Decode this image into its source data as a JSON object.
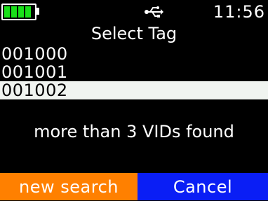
{
  "status_bar": {
    "battery_level": 1.0,
    "battery_color": "#19e019",
    "usb_icon": "usb-icon",
    "time": "11:56"
  },
  "screen": {
    "title": "Select Tag",
    "tags": [
      {
        "id": "001000",
        "selected": false
      },
      {
        "id": "001001",
        "selected": false
      },
      {
        "id": "001002",
        "selected": true
      }
    ],
    "message": "more than 3 VIDs found"
  },
  "softkeys": {
    "left_label": "new search",
    "left_color": "#ff8000",
    "right_label": "Cancel",
    "right_color": "#0a1ef5"
  }
}
